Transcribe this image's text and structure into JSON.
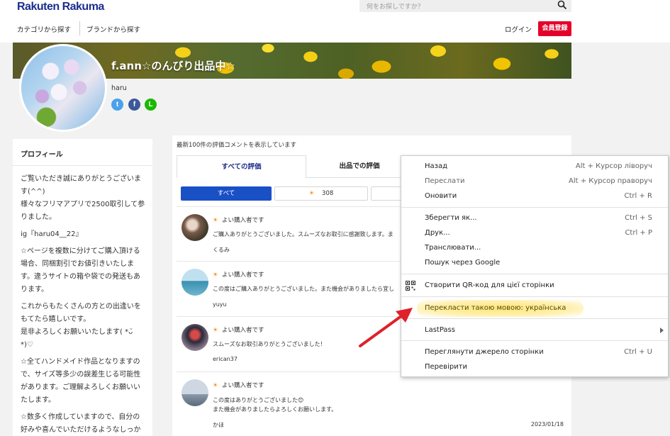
{
  "header": {
    "logo": "Rakuten Rakuma",
    "search_placeholder": "何をお探しですか？",
    "nav_category": "カテゴリから探す",
    "nav_brand": "ブランドから探す",
    "login": "ログイン",
    "register": "会員登録"
  },
  "shop": {
    "title": "f.ann☆のんびり出品中☆",
    "username": "haru",
    "social": {
      "twitter": "t",
      "facebook": "f",
      "line": "L"
    }
  },
  "profile": {
    "heading": "プロフィール",
    "paragraphs": [
      "ご覧いただき誠にありがとうございます(^^)\n様々なフリマアプリで2500取引して参りました。",
      "ig『haru04__22』",
      "☆ページを複数に分けてご購入頂ける場合、同梱割引でお値引きいたします。違うサイトの箱や袋での発送もあります。",
      "これからもたくさんの方との出逢いをもてたら嬉しいです。\n是非よろしくお願いいたします( *ᴗ̈ *)♡",
      "☆全てハンドメイド作品となりますので、サイズ等多少の誤差生じる可能性があります。ご理解よろしくお願いいたします。",
      "☆数多く作成していますので、自分の好みや喜んでいただけるようなしっかりした商品をお届けできるように"
    ]
  },
  "reviews_panel": {
    "note": "最新100件の評価コメントを表示しています",
    "tab_all": "すべての評価",
    "tab_selling": "出品での評価",
    "filter_all": "すべて",
    "filter_good_icon": "☀",
    "filter_good_count": "308",
    "items": [
      {
        "rating_icon": "☀",
        "rating": "よい購入者です",
        "text": "ご購入ありがとうございました。スムーズなお取引に感謝致します。ま",
        "user": "くるみ",
        "date": ""
      },
      {
        "rating_icon": "☀",
        "rating": "よい購入者です",
        "text": "この度はご購入ありがとうございました。また機会がありましたら宜し",
        "user": "yuyu",
        "date": ""
      },
      {
        "rating_icon": "☀",
        "rating": "よい購入者です",
        "text": "スムーズなお取引ありがとうございました！",
        "user": "erican37",
        "date": ""
      },
      {
        "rating_icon": "☀",
        "rating": "よい購入者です",
        "text": "この度はありがとうございました😊\nまた機会がありましたらよろしくお願いします。",
        "user": "かほ",
        "date": "2023/01/18"
      }
    ]
  },
  "context_menu": {
    "items": [
      {
        "label": "Назад",
        "shortcut": "Alt + Курсор ліворуч",
        "dim": false
      },
      {
        "label": "Переслати",
        "shortcut": "Alt + Курсор праворуч",
        "dim": true
      },
      {
        "label": "Оновити",
        "shortcut": "Ctrl + R",
        "dim": false
      },
      {
        "label": "Зберегти як...",
        "shortcut": "Ctrl + S",
        "dim": false
      },
      {
        "label": "Друк...",
        "shortcut": "Ctrl + P",
        "dim": false
      },
      {
        "label": "Транслювати...",
        "shortcut": "",
        "dim": false
      },
      {
        "label": "Пошук через Google",
        "shortcut": "",
        "dim": false
      },
      {
        "label": "Створити QR-код для цієї сторінки",
        "shortcut": "",
        "dim": false
      },
      {
        "label": "Перекласти такою мовою: українська",
        "shortcut": "",
        "dim": false
      },
      {
        "label": "LastPass",
        "shortcut": "",
        "dim": false
      },
      {
        "label": "Переглянути джерело сторінки",
        "shortcut": "Ctrl + U",
        "dim": false
      },
      {
        "label": "Перевірити",
        "shortcut": "",
        "dim": false
      }
    ]
  },
  "colors": {
    "brand_blue": "#1d2d8c",
    "register_red": "#e4002b",
    "filter_active": "#1a50c6",
    "annotation_arrow": "#e0202a",
    "highlight": "#ffe264"
  }
}
